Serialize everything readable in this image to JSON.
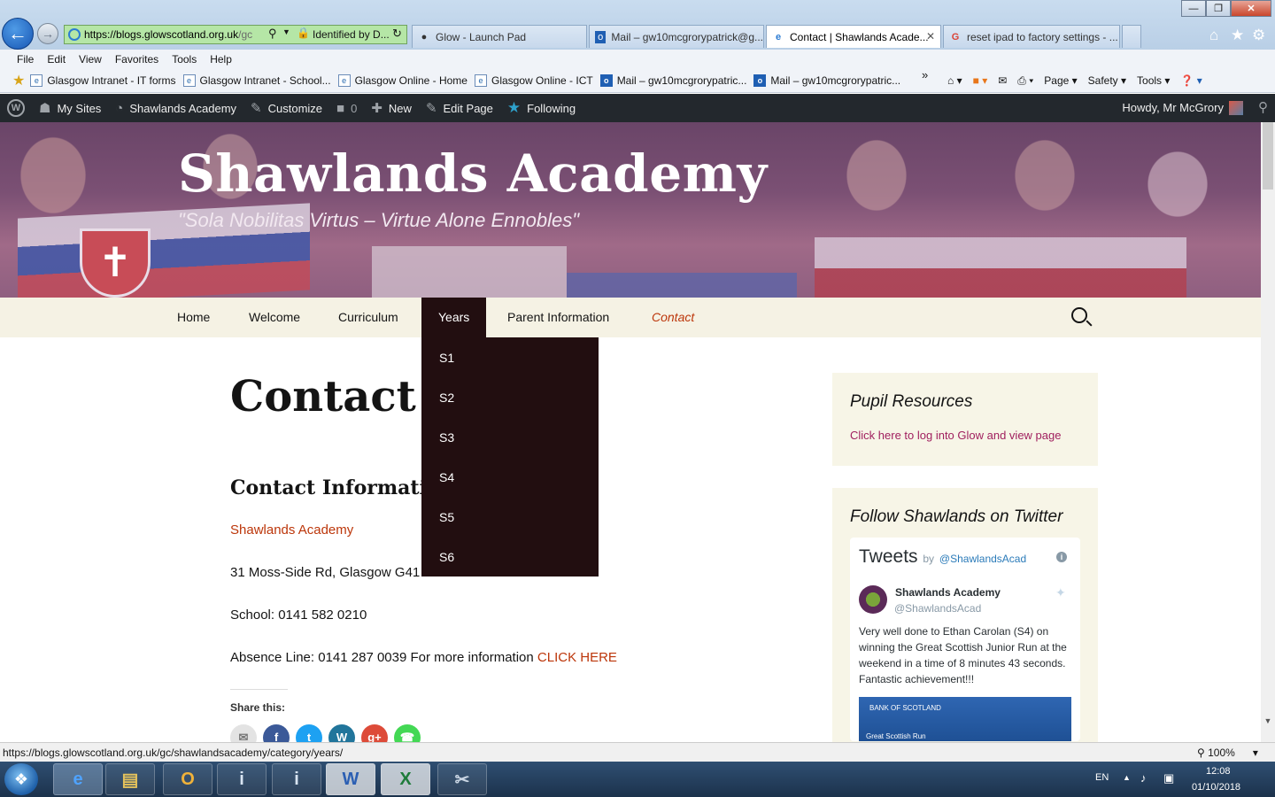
{
  "browser": {
    "address_host": "https://blogs.glowscotland.org.uk",
    "address_path": "/gc",
    "identified": "Identified by D...",
    "tabs": [
      {
        "label": "Glow - Launch Pad",
        "icon": "glow-icon"
      },
      {
        "label": "Mail – gw10mcgrorypatrick@g...",
        "icon": "outlook-icon"
      },
      {
        "label": "Contact | Shawlands Acade...",
        "icon": "ie-icon",
        "active": true
      },
      {
        "label": "reset ipad to factory settings - ...",
        "icon": "google-icon"
      }
    ],
    "menu": [
      "File",
      "Edit",
      "View",
      "Favorites",
      "Tools",
      "Help"
    ],
    "favorites": [
      "Glasgow Intranet - IT forms",
      "Glasgow Intranet - School...",
      "Glasgow Online - Home",
      "Glasgow Online - ICT",
      "Mail – gw10mcgrorypatric...",
      "Mail – gw10mcgrorypatric..."
    ],
    "commands": {
      "page": "Page",
      "safety": "Safety",
      "tools": "Tools"
    },
    "status_url": "https://blogs.glowscotland.org.uk/gc/shawlandsacademy/category/years/",
    "zoom": "100%"
  },
  "wp_admin_bar": {
    "my_sites": "My Sites",
    "site_name": "Shawlands Academy",
    "customize": "Customize",
    "comments_count": "0",
    "new": "New",
    "edit_page": "Edit Page",
    "following": "Following",
    "howdy": "Howdy, Mr McGrory"
  },
  "site": {
    "title": "Shawlands Academy",
    "tagline": "\"Sola Nobilitas Virtus – Virtue Alone Ennobles\""
  },
  "nav": {
    "items": [
      "Home",
      "Welcome",
      "Curriculum",
      "Years",
      "Parent Information",
      "Contact"
    ],
    "active": "Years",
    "current": "Contact",
    "years_dropdown": [
      "S1",
      "S2",
      "S3",
      "S4",
      "S5",
      "S6"
    ]
  },
  "content": {
    "title": "Contact",
    "subtitle": "Contact Informatio",
    "school_link": "Shawlands Academy",
    "address": "31 Moss-Side Rd, Glasgow G41 3",
    "school_phone": "School: 0141 582 0210",
    "absence_line": "Absence Line: 0141 287 0039 For more information ",
    "absence_link": "CLICK HERE",
    "share_label": "Share this:"
  },
  "sidebar": {
    "pupil_title": "Pupil Resources",
    "pupil_link": "Click here to log into Glow and view page",
    "twitter_title": "Follow Shawlands on Twitter",
    "twitter": {
      "header": "Tweets",
      "by": "by",
      "handle_link": "@ShawlandsAcad",
      "account_name": "Shawlands Academy",
      "account_handle": "@ShawlandsAcad",
      "tweet_text": "Very well done to Ethan Carolan (S4) on winning the Great Scottish Junior Run at the weekend in a time of 8 minutes 43 seconds. Fantastic achievement!!!",
      "image_text_1": "BANK OF SCOTLAND",
      "image_text_2": "Great Scottish Run"
    }
  },
  "taskbar": {
    "lang": "EN",
    "time": "12:08",
    "date": "01/10/2018"
  },
  "colors": {
    "nav_bg": "#f5f2e4",
    "dropdown_bg": "#220e10",
    "link": "#bc360a",
    "wp_bar": "#23282d"
  }
}
